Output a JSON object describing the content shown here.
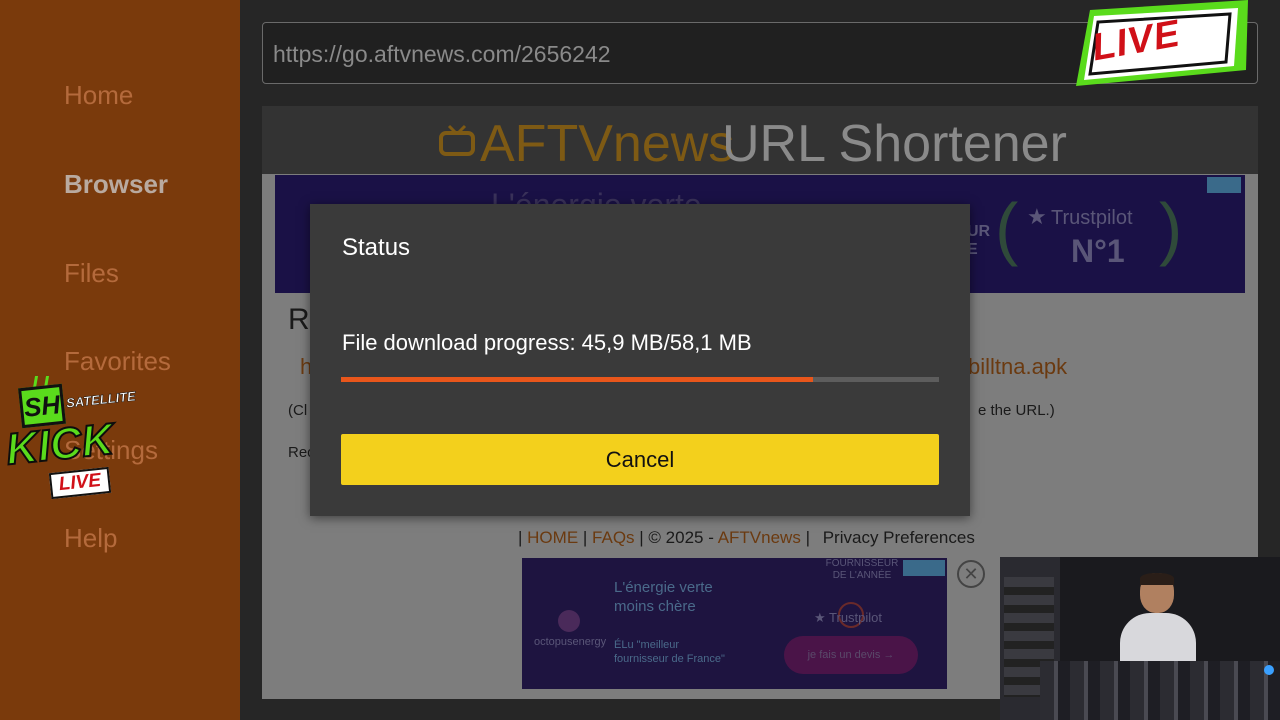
{
  "sidebar": {
    "items": [
      {
        "label": "Home"
      },
      {
        "label": "Browser"
      },
      {
        "label": "Files"
      },
      {
        "label": "Favorites"
      },
      {
        "label": "Settings"
      },
      {
        "label": "Help"
      }
    ]
  },
  "browser": {
    "url": "https://go.aftvnews.com/2656242"
  },
  "site": {
    "brand": "AFTVnews",
    "title": "URL Shortener",
    "content_r": "R",
    "content_h": "h",
    "content_apk": "billtna.apk",
    "content_cl": "(Cl",
    "content_url_tail": "e the URL.)",
    "content_rec": "Rec"
  },
  "ad_top": {
    "top_text": "L'énergie verte",
    "ur_text": "UR\nE",
    "trustpilot": "Trustpilot",
    "rank": "N°1"
  },
  "footer": {
    "sep1": "|",
    "home": "HOME",
    "sep2": "|",
    "faqs": "FAQs",
    "copyright": "| © 2025 -",
    "brand": "AFTVnews",
    "sep3": "|",
    "privacy": "Privacy Preferences"
  },
  "ad_bottom": {
    "logo": "octopusenergy",
    "headline_1": "L'énergie verte",
    "headline_2": "moins chère",
    "sub_1": "ÉLu \"meilleur",
    "sub_2": "fournisseur de France\"",
    "award_1": "FOURNISSEUR",
    "award_2": "DE L'ANNÉE",
    "trustpilot": "Trustpilot",
    "cta": "je fais un devis →",
    "close_symbol": "✕"
  },
  "dialog": {
    "title": "Status",
    "message": "File download progress: 45,9 MB/58,1 MB",
    "progress": 0.79,
    "cancel_label": "Cancel"
  },
  "overlay": {
    "live_badge": "LIVE",
    "kick_sh": "SH",
    "kick_satellite": "SATELLITE",
    "kick_word": "KICK",
    "kick_live": "LIVE"
  },
  "colors": {
    "sidebar_bg": "#7a3a0c",
    "progress_fill": "#e8561b",
    "cancel_button": "#f3d01c",
    "live_green": "#5adb1c",
    "live_red": "#d01018"
  }
}
